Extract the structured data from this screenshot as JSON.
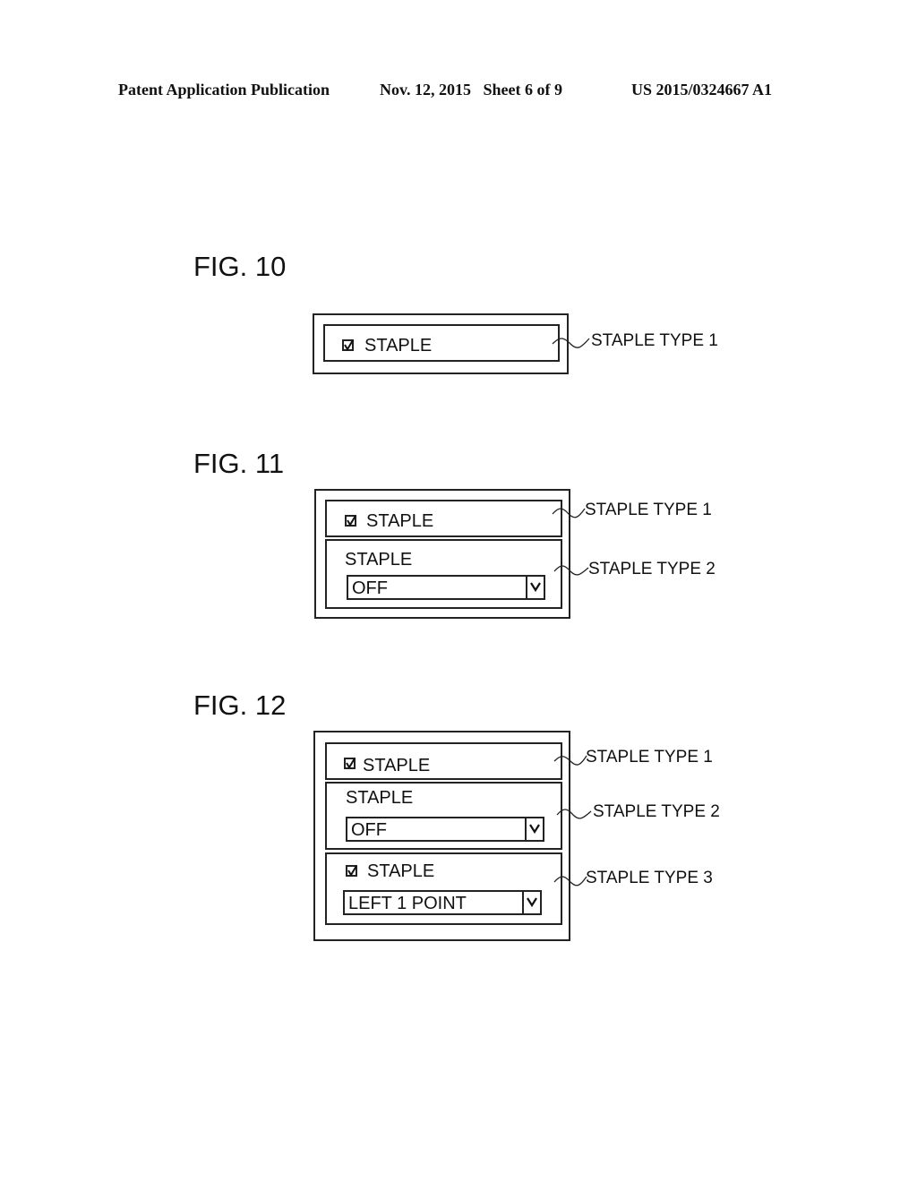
{
  "header": {
    "publication": "Patent Application Publication",
    "date_sheet": "Nov. 12, 2015   Sheet 6 of 9",
    "number": "US 2015/0324667 A1"
  },
  "figures": [
    {
      "label": "FIG. 10",
      "panels": [
        {
          "type": "checkbox",
          "label": "STAPLE",
          "checked": true,
          "callout": "STAPLE TYPE 1"
        }
      ]
    },
    {
      "label": "FIG. 11",
      "panels": [
        {
          "type": "checkbox",
          "label": "STAPLE",
          "checked": true,
          "callout": "STAPLE TYPE 1"
        },
        {
          "type": "dropdown",
          "label": "STAPLE",
          "value": "OFF",
          "callout": "STAPLE TYPE 2"
        }
      ]
    },
    {
      "label": "FIG. 12",
      "panels": [
        {
          "type": "checkbox",
          "label": "STAPLE",
          "checked": true,
          "callout": "STAPLE TYPE 1"
        },
        {
          "type": "dropdown",
          "label": "STAPLE",
          "value": "OFF",
          "callout": "STAPLE TYPE 2"
        },
        {
          "type": "checkbox-dropdown",
          "label": "STAPLE",
          "checked": true,
          "value": "LEFT 1 POINT",
          "callout": "STAPLE TYPE 3"
        }
      ]
    }
  ],
  "icons": {
    "checkbox": "checkbox-checked-icon",
    "dropdown": "chevron-down-icon",
    "leader": "tilde-leader-line"
  }
}
